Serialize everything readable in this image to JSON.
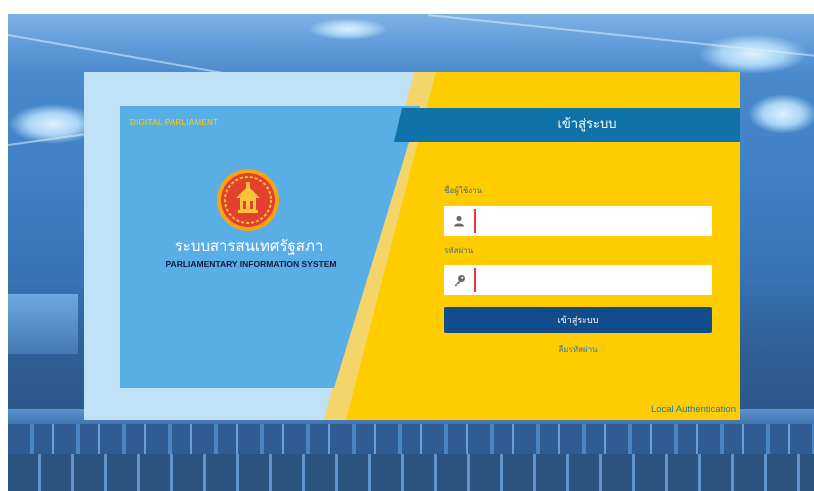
{
  "branding": {
    "tagline": "DIGITAL PARLIAMENT",
    "title_thai": "ระบบสารสนเทศรัฐสภา",
    "title_english": "PARLIAMENTARY INFORMATION SYSTEM",
    "emblem_icon": "parliament-emblem-icon"
  },
  "login": {
    "header": "เข้าสู่ระบบ",
    "username_label": "ชื่อผู้ใช้งาน",
    "username_value": "",
    "username_icon": "user-icon",
    "password_label": "รหัสผ่าน",
    "password_value": "",
    "password_icon": "key-icon",
    "submit_label": "เข้าสู่ระบบ",
    "forgot_password": "ลืมรหัสผ่าน",
    "auth_mode": "Local Authentication"
  },
  "colors": {
    "accent_yellow": "#ffcc00",
    "header_blue": "#0f72a8",
    "button_navy": "#114d8a",
    "panel_blue": "#5aaee6",
    "brand_gold": "#ffd200",
    "field_divider_red": "#e8373c"
  }
}
